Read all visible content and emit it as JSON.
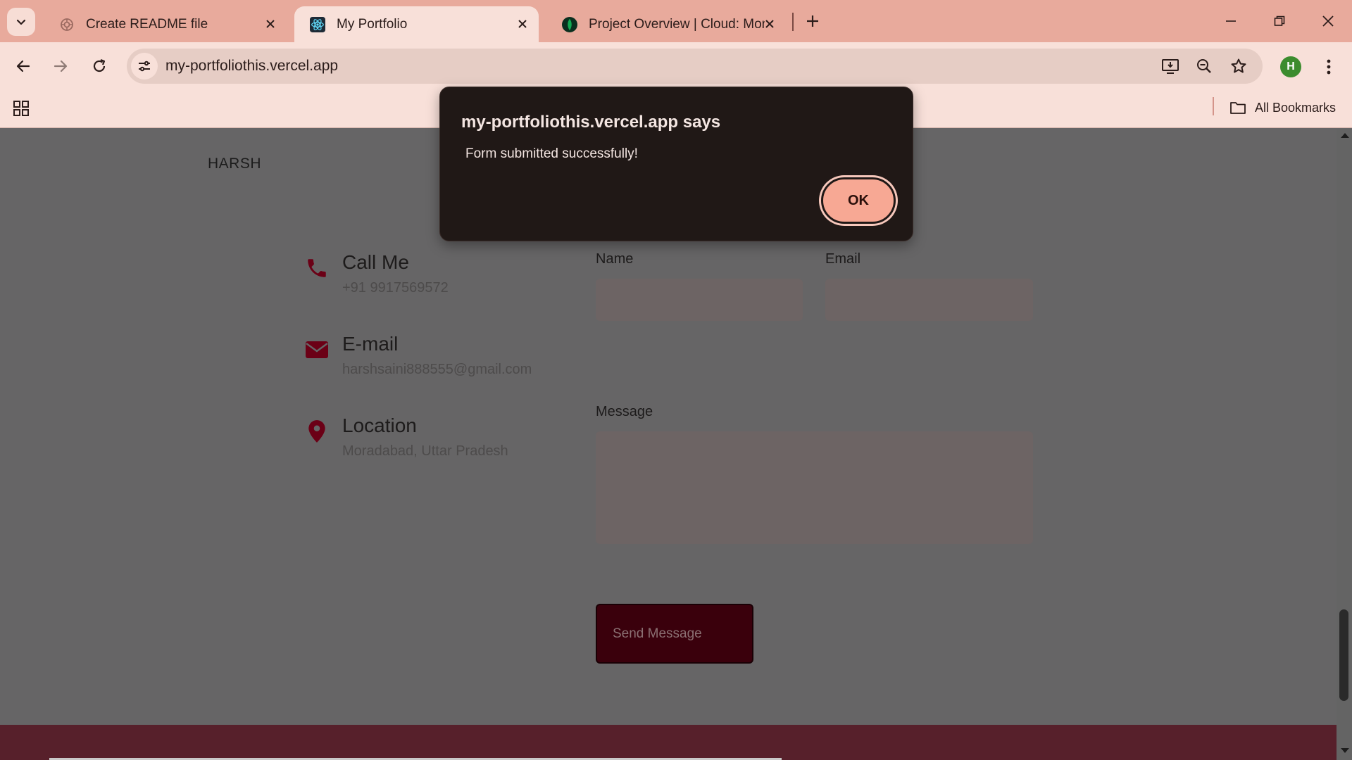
{
  "browser": {
    "tabs": [
      {
        "title": "Create README file",
        "active": false
      },
      {
        "title": "My Portfolio",
        "active": true
      },
      {
        "title": "Project Overview | Cloud: Mong",
        "active": false
      }
    ],
    "url": "my-portfoliothis.vercel.app",
    "profile_initial": "H",
    "all_bookmarks_label": "All Bookmarks",
    "colors": {
      "tabstrip": "#e8aa9c",
      "toolbar": "#f8e0d9",
      "avatar": "#3c8c2e"
    }
  },
  "page": {
    "brand": "HARSH",
    "contacts": [
      {
        "icon": "phone-icon",
        "title": "Call Me",
        "value": "+91 9917569572"
      },
      {
        "icon": "envelope-icon",
        "title": "E-mail",
        "value": "harshsaini888555@gmail.com"
      },
      {
        "icon": "location-pin-icon",
        "title": "Location",
        "value": "Moradabad, Uttar Pradesh"
      }
    ],
    "form": {
      "name_label": "Name",
      "email_label": "Email",
      "message_label": "Message",
      "name_value": "",
      "email_value": "",
      "message_value": "",
      "submit_label": "Send Message"
    },
    "colors": {
      "background": "#666566",
      "accent": "#6b0016",
      "footer": "#57202b",
      "button": "#3a000c"
    }
  },
  "alert": {
    "title": "my-portfoliothis.vercel.app says",
    "message": "Form submitted successfully!",
    "ok_label": "OK"
  }
}
